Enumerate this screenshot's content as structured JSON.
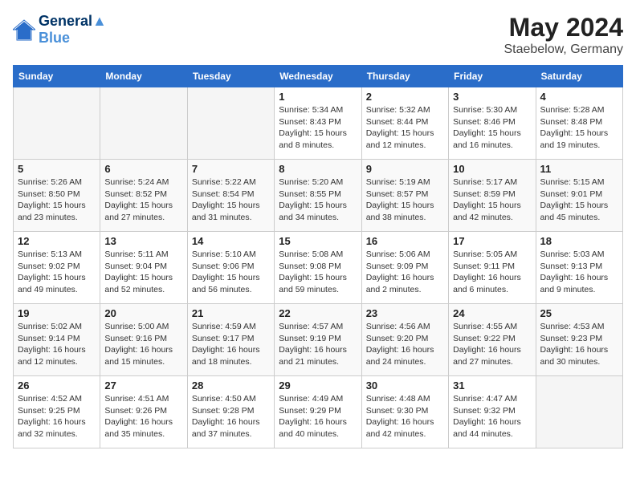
{
  "header": {
    "logo_line1": "General",
    "logo_line2": "Blue",
    "title": "May 2024",
    "location": "Staebelow, Germany"
  },
  "weekdays": [
    "Sunday",
    "Monday",
    "Tuesday",
    "Wednesday",
    "Thursday",
    "Friday",
    "Saturday"
  ],
  "weeks": [
    [
      {
        "day": "",
        "info": ""
      },
      {
        "day": "",
        "info": ""
      },
      {
        "day": "",
        "info": ""
      },
      {
        "day": "1",
        "info": "Sunrise: 5:34 AM\nSunset: 8:43 PM\nDaylight: 15 hours\nand 8 minutes."
      },
      {
        "day": "2",
        "info": "Sunrise: 5:32 AM\nSunset: 8:44 PM\nDaylight: 15 hours\nand 12 minutes."
      },
      {
        "day": "3",
        "info": "Sunrise: 5:30 AM\nSunset: 8:46 PM\nDaylight: 15 hours\nand 16 minutes."
      },
      {
        "day": "4",
        "info": "Sunrise: 5:28 AM\nSunset: 8:48 PM\nDaylight: 15 hours\nand 19 minutes."
      }
    ],
    [
      {
        "day": "5",
        "info": "Sunrise: 5:26 AM\nSunset: 8:50 PM\nDaylight: 15 hours\nand 23 minutes."
      },
      {
        "day": "6",
        "info": "Sunrise: 5:24 AM\nSunset: 8:52 PM\nDaylight: 15 hours\nand 27 minutes."
      },
      {
        "day": "7",
        "info": "Sunrise: 5:22 AM\nSunset: 8:54 PM\nDaylight: 15 hours\nand 31 minutes."
      },
      {
        "day": "8",
        "info": "Sunrise: 5:20 AM\nSunset: 8:55 PM\nDaylight: 15 hours\nand 34 minutes."
      },
      {
        "day": "9",
        "info": "Sunrise: 5:19 AM\nSunset: 8:57 PM\nDaylight: 15 hours\nand 38 minutes."
      },
      {
        "day": "10",
        "info": "Sunrise: 5:17 AM\nSunset: 8:59 PM\nDaylight: 15 hours\nand 42 minutes."
      },
      {
        "day": "11",
        "info": "Sunrise: 5:15 AM\nSunset: 9:01 PM\nDaylight: 15 hours\nand 45 minutes."
      }
    ],
    [
      {
        "day": "12",
        "info": "Sunrise: 5:13 AM\nSunset: 9:02 PM\nDaylight: 15 hours\nand 49 minutes."
      },
      {
        "day": "13",
        "info": "Sunrise: 5:11 AM\nSunset: 9:04 PM\nDaylight: 15 hours\nand 52 minutes."
      },
      {
        "day": "14",
        "info": "Sunrise: 5:10 AM\nSunset: 9:06 PM\nDaylight: 15 hours\nand 56 minutes."
      },
      {
        "day": "15",
        "info": "Sunrise: 5:08 AM\nSunset: 9:08 PM\nDaylight: 15 hours\nand 59 minutes."
      },
      {
        "day": "16",
        "info": "Sunrise: 5:06 AM\nSunset: 9:09 PM\nDaylight: 16 hours\nand 2 minutes."
      },
      {
        "day": "17",
        "info": "Sunrise: 5:05 AM\nSunset: 9:11 PM\nDaylight: 16 hours\nand 6 minutes."
      },
      {
        "day": "18",
        "info": "Sunrise: 5:03 AM\nSunset: 9:13 PM\nDaylight: 16 hours\nand 9 minutes."
      }
    ],
    [
      {
        "day": "19",
        "info": "Sunrise: 5:02 AM\nSunset: 9:14 PM\nDaylight: 16 hours\nand 12 minutes."
      },
      {
        "day": "20",
        "info": "Sunrise: 5:00 AM\nSunset: 9:16 PM\nDaylight: 16 hours\nand 15 minutes."
      },
      {
        "day": "21",
        "info": "Sunrise: 4:59 AM\nSunset: 9:17 PM\nDaylight: 16 hours\nand 18 minutes."
      },
      {
        "day": "22",
        "info": "Sunrise: 4:57 AM\nSunset: 9:19 PM\nDaylight: 16 hours\nand 21 minutes."
      },
      {
        "day": "23",
        "info": "Sunrise: 4:56 AM\nSunset: 9:20 PM\nDaylight: 16 hours\nand 24 minutes."
      },
      {
        "day": "24",
        "info": "Sunrise: 4:55 AM\nSunset: 9:22 PM\nDaylight: 16 hours\nand 27 minutes."
      },
      {
        "day": "25",
        "info": "Sunrise: 4:53 AM\nSunset: 9:23 PM\nDaylight: 16 hours\nand 30 minutes."
      }
    ],
    [
      {
        "day": "26",
        "info": "Sunrise: 4:52 AM\nSunset: 9:25 PM\nDaylight: 16 hours\nand 32 minutes."
      },
      {
        "day": "27",
        "info": "Sunrise: 4:51 AM\nSunset: 9:26 PM\nDaylight: 16 hours\nand 35 minutes."
      },
      {
        "day": "28",
        "info": "Sunrise: 4:50 AM\nSunset: 9:28 PM\nDaylight: 16 hours\nand 37 minutes."
      },
      {
        "day": "29",
        "info": "Sunrise: 4:49 AM\nSunset: 9:29 PM\nDaylight: 16 hours\nand 40 minutes."
      },
      {
        "day": "30",
        "info": "Sunrise: 4:48 AM\nSunset: 9:30 PM\nDaylight: 16 hours\nand 42 minutes."
      },
      {
        "day": "31",
        "info": "Sunrise: 4:47 AM\nSunset: 9:32 PM\nDaylight: 16 hours\nand 44 minutes."
      },
      {
        "day": "",
        "info": ""
      }
    ]
  ]
}
